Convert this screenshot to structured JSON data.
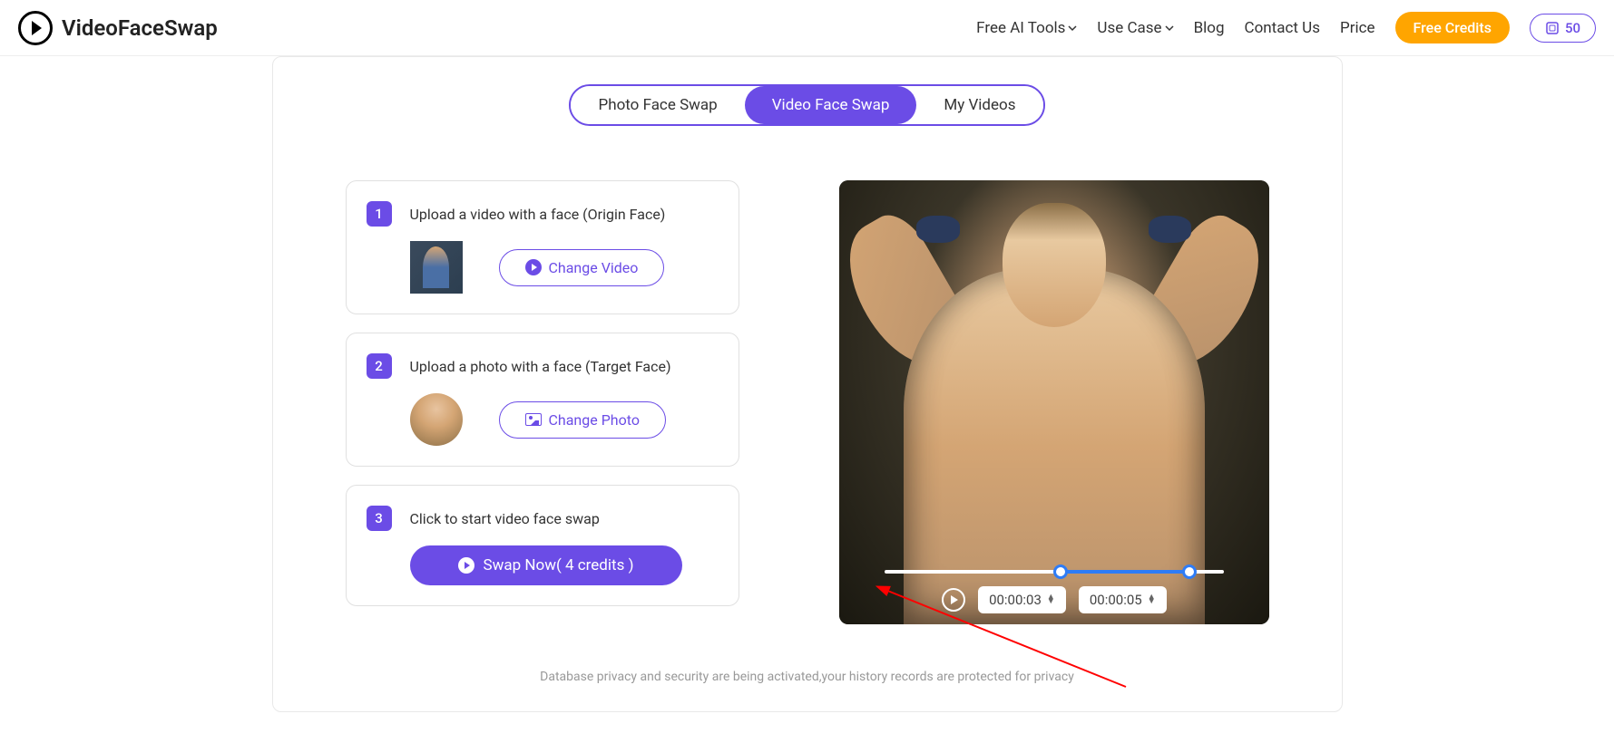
{
  "header": {
    "brand": "VideoFaceSwap",
    "nav": {
      "tools": "Free AI Tools",
      "use_case": "Use Case",
      "blog": "Blog",
      "contact": "Contact Us",
      "price": "Price"
    },
    "free_credits_btn": "Free Credits",
    "credits_count": "50"
  },
  "tabs": {
    "photo": "Photo Face Swap",
    "video": "Video Face Swap",
    "my_videos": "My Videos"
  },
  "steps": {
    "s1": {
      "num": "1",
      "title": "Upload a video with a face  (Origin Face)",
      "btn": "Change Video"
    },
    "s2": {
      "num": "2",
      "title": "Upload a photo with a face  (Target Face)",
      "btn": "Change Photo"
    },
    "s3": {
      "num": "3",
      "title": "Click to start video face swap",
      "btn": "Swap Now( 4 credits )"
    }
  },
  "video_player": {
    "time_start": "00:00:03",
    "time_end": "00:00:05"
  },
  "footer_note": "Database privacy and security are being activated,your history records are protected for privacy"
}
